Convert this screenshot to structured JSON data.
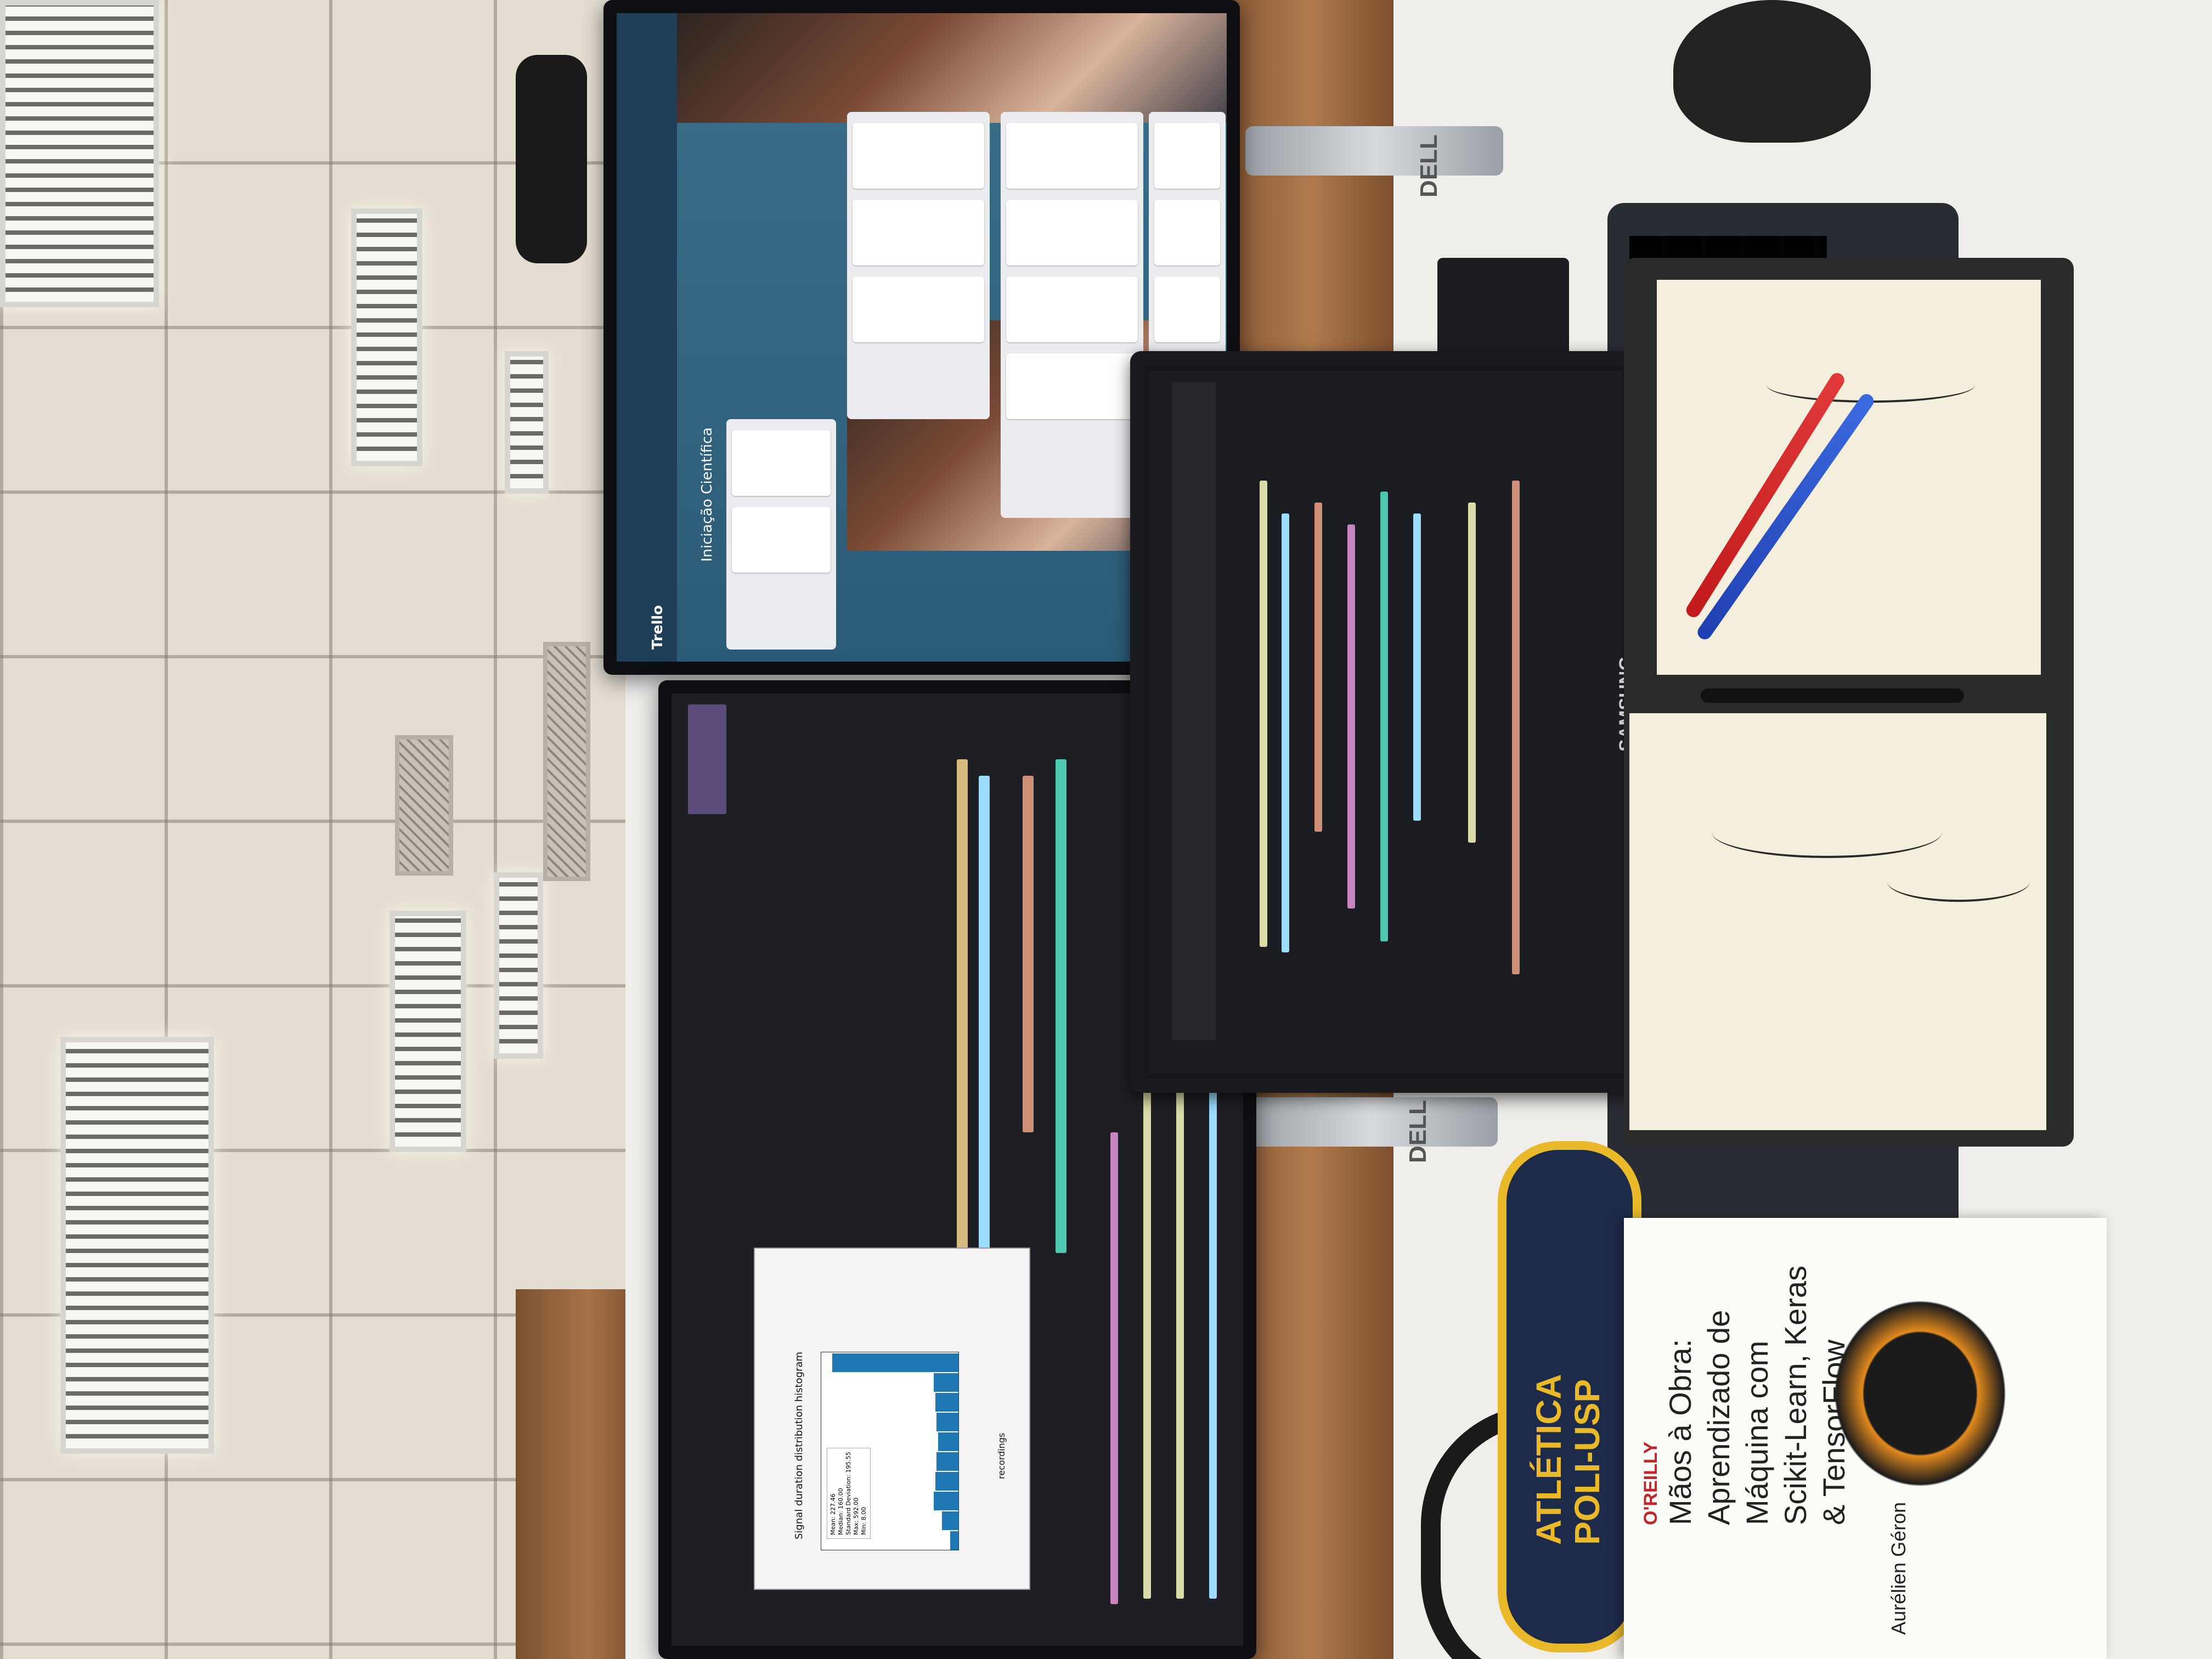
{
  "scene": "Desk workspace photographed from above (rotated view)",
  "book": {
    "publisher": "O'REILLY",
    "title_line1": "Mãos à Obra:",
    "title_line2": "Aprendizado de",
    "title_line3": "Máquina com",
    "title_line4": "Scikit-Learn, Keras",
    "title_line5": "& TensorFlow",
    "author": "Aurélien Géron"
  },
  "pencil_case": {
    "line1": "ATLÉTICA",
    "line2": "POLI-USP"
  },
  "laptop": {
    "brand": "SAMSUNG"
  },
  "monitors": {
    "brand": "DELL"
  },
  "top_monitor": {
    "app": "Trello",
    "board_title": "Iniciação Científica"
  },
  "bottom_monitor": {
    "plot_title": "Signal duration distribution histogram",
    "plot_xlabel": "recordings",
    "legend": [
      "Mean: 227.46",
      "Median: 160.00",
      "Standard Deviation: 195.55",
      "Max: 592.00",
      "Min: 8.00"
    ]
  }
}
